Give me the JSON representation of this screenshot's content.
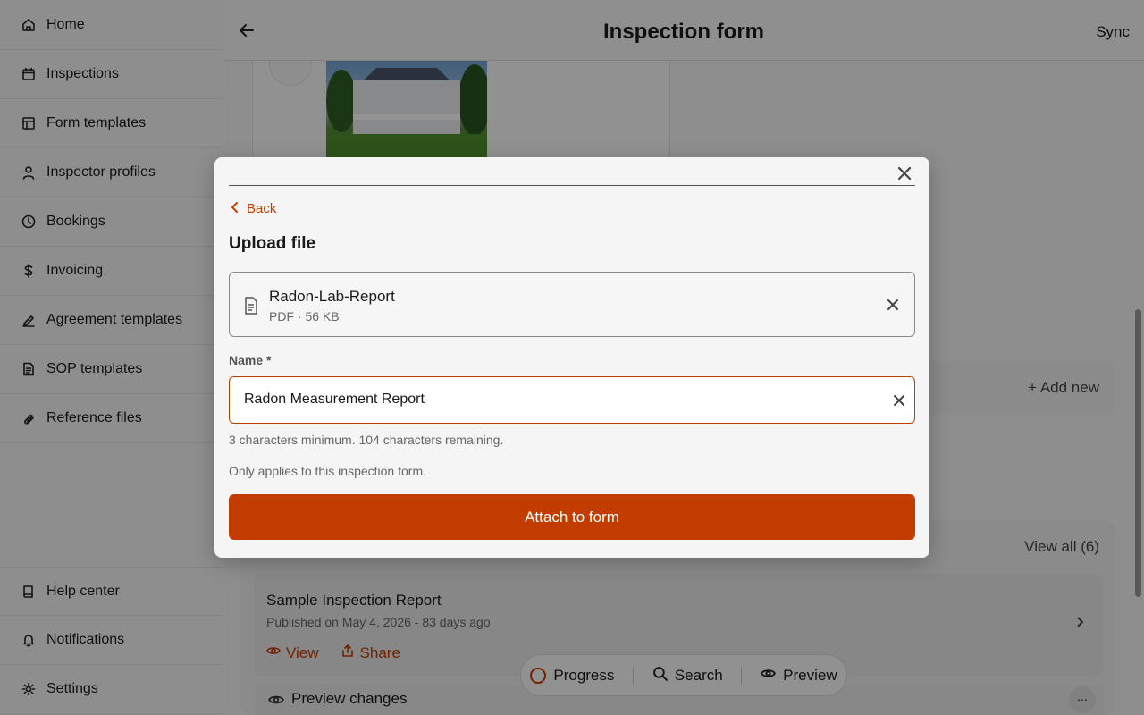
{
  "sidebar": {
    "items": [
      {
        "label": "Home",
        "icon": "home-icon"
      },
      {
        "label": "Inspections",
        "icon": "calendar-icon"
      },
      {
        "label": "Form templates",
        "icon": "layout-icon"
      },
      {
        "label": "Inspector profiles",
        "icon": "user-icon"
      },
      {
        "label": "Bookings",
        "icon": "clock-icon"
      },
      {
        "label": "Invoicing",
        "icon": "dollar-icon"
      },
      {
        "label": "Agreement templates",
        "icon": "signature-icon"
      },
      {
        "label": "SOP templates",
        "icon": "document-icon"
      },
      {
        "label": "Reference files",
        "icon": "paperclip-icon"
      }
    ],
    "bottom_items": [
      {
        "label": "Help center",
        "icon": "book-icon"
      },
      {
        "label": "Notifications",
        "icon": "bell-icon"
      },
      {
        "label": "Settings",
        "icon": "gear-icon"
      }
    ]
  },
  "header": {
    "title": "Inspection form",
    "sync_label": "Sync"
  },
  "background": {
    "add_new_label": "+ Add new",
    "view_all_label": "View all (6)",
    "report": {
      "title": "Sample Inspection Report",
      "subtitle": "Published on May 4, 2026 - 83 days ago",
      "view_label": "View",
      "share_label": "Share"
    },
    "preview_changes_label": "Preview changes",
    "more_label": "..."
  },
  "bottom_bar": {
    "progress_label": "Progress",
    "search_label": "Search",
    "preview_label": "Preview"
  },
  "modal": {
    "back_label": "Back",
    "title": "Upload file",
    "file": {
      "name": "Radon-Lab-Report",
      "meta": "PDF · 56 KB"
    },
    "name_field": {
      "label": "Name *",
      "value": "Radon Measurement Report"
    },
    "hint_chars": "3 characters minimum. 104 characters remaining.",
    "hint_scope": "Only applies to this inspection form.",
    "attach_label": "Attach to form"
  },
  "colors": {
    "accent": "#c23c00",
    "overlay": "rgba(0,0,0,0.42)"
  }
}
